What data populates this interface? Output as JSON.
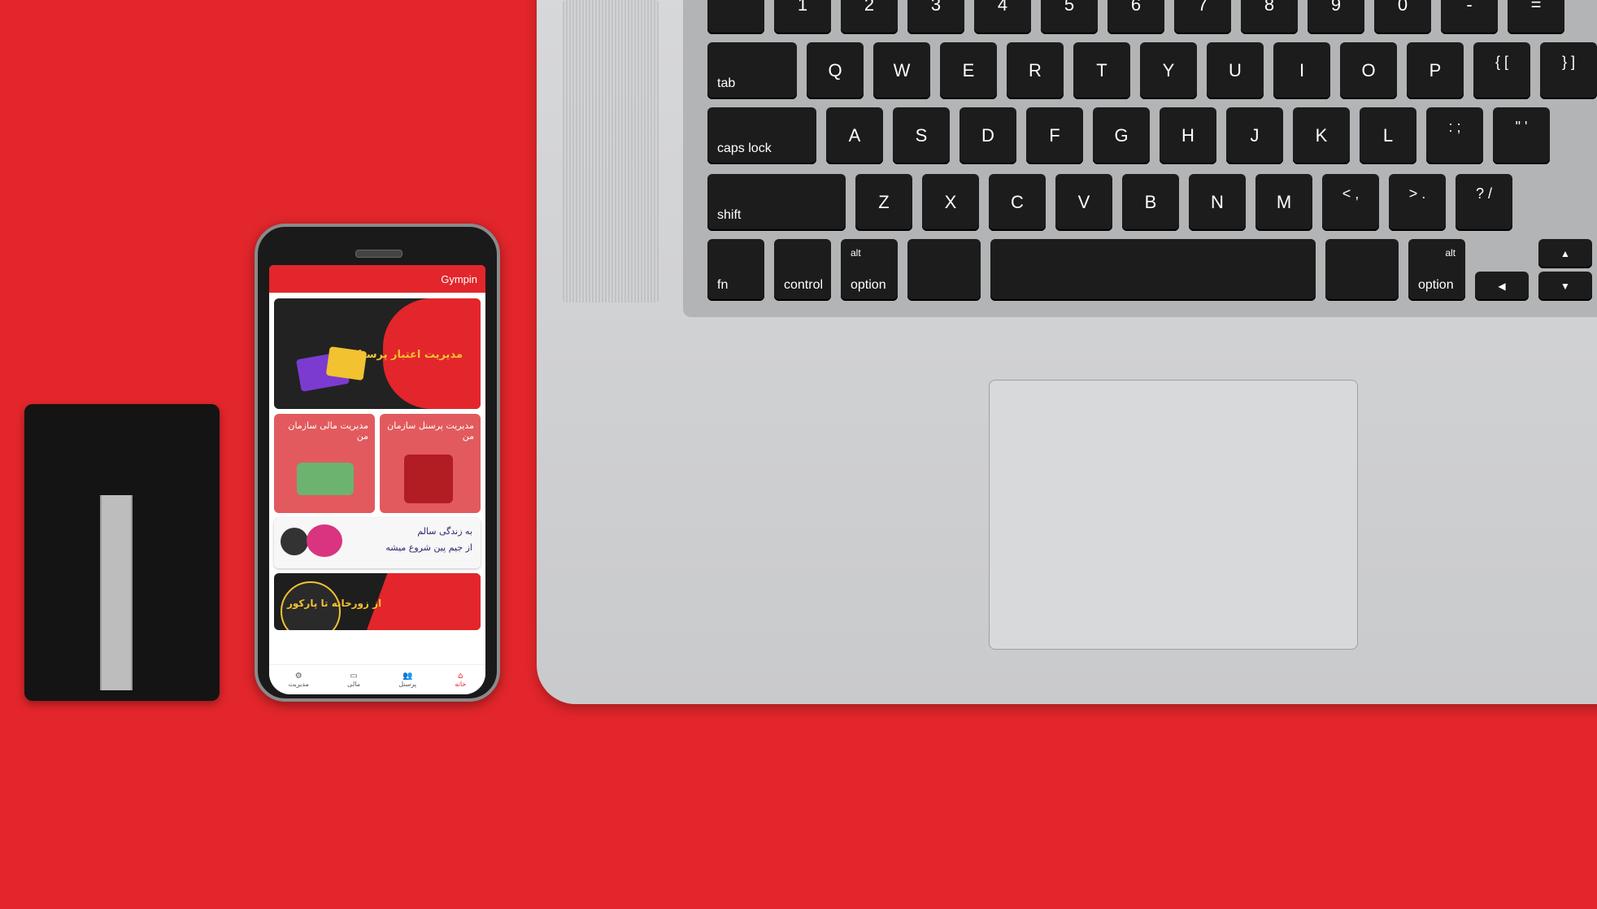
{
  "phone": {
    "app_title": "Gympin",
    "banners": {
      "credit_title": "مدیریت اعتبار پرسنل",
      "financial_title": "مدیریت مالی سازمان من",
      "staff_title": "مدیریت پرسنل سازمان من",
      "health_line1": "به زندگی سالم",
      "health_line2": "از جیم پین شروع میشه",
      "zurkhane": "از زورخانه تا پارکور"
    },
    "nav": [
      {
        "label": "مدیریت",
        "icon": "manage-icon"
      },
      {
        "label": "مالی",
        "icon": "card-icon"
      },
      {
        "label": "پرسنل",
        "icon": "people-icon"
      },
      {
        "label": "خانه",
        "icon": "home-icon"
      }
    ]
  },
  "laptop": {
    "keys": {
      "row0": [
        "`",
        "1",
        "2",
        "3",
        "4",
        "5",
        "6",
        "7",
        "8",
        "9",
        "0",
        "-",
        "="
      ],
      "row1": [
        "tab",
        "Q",
        "W",
        "E",
        "R",
        "T",
        "Y",
        "U",
        "I",
        "O",
        "P",
        "{ [",
        "} ]"
      ],
      "row2": [
        "caps lock",
        "A",
        "S",
        "D",
        "F",
        "G",
        "H",
        "J",
        "K",
        "L",
        ": ;",
        "\" '"
      ],
      "row3": [
        "shift",
        "Z",
        "X",
        "C",
        "V",
        "B",
        "N",
        "M",
        "< ,",
        "> .",
        "? /"
      ],
      "row4": [
        "fn",
        "control",
        "alt",
        "option",
        "alt",
        "option",
        "◀",
        "▲",
        "▼"
      ]
    }
  }
}
